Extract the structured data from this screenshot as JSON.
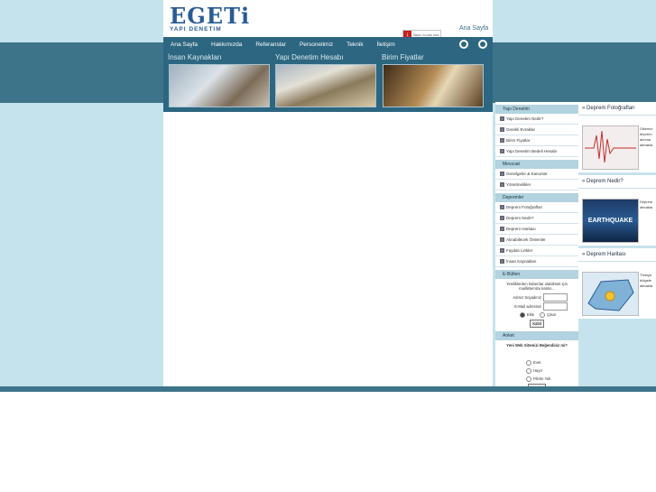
{
  "logo": {
    "word": "EGETi",
    "sub": "YAPI DENETIM"
  },
  "header": {
    "ana_sayfa": "Ana Sayfa",
    "badge_icon": "pdf-icon",
    "badge_text": "İNDİR / KLASİK SİTE"
  },
  "nav": [
    "Ana Sayfa",
    "Hakkımızda",
    "Referanslar",
    "Personelimiz",
    "Teknik",
    "İletişim"
  ],
  "hero": [
    {
      "title": "İnsan Kaynakları"
    },
    {
      "title": "Yapı Denetim Hesabı"
    },
    {
      "title": "Birim Fiyatlar"
    }
  ],
  "sidebar": {
    "yapi_denetim": {
      "title": "Yapı Denetim",
      "items": [
        "Yapı Denetim Nedir?",
        "Gerekli Evraklar",
        "Birim Fiyatlar",
        "Yapı Denetim Bedeli Hesabı"
      ]
    },
    "mevzuat": {
      "title": "Mevzuat",
      "items": [
        "Genelgeler & Kanunlar",
        "Yönetmelikler"
      ]
    },
    "depremler": {
      "title": "Depremler",
      "items": [
        "Deprem Fotoğrafları",
        "Deprem Nedir?",
        "Deprem Haritası",
        "Alınabilecek Önlemler",
        "Faydalı Linkler",
        "İnsan Kaynakları"
      ]
    },
    "ebulten": {
      "title": "E-Bülten",
      "desc": "Yeniliklerden haberdar olabilmek için maillistemize katılın...",
      "name_label": "Adınız Soyadınız",
      "email_label": "E-Mail adresiniz",
      "opt_add": "Ekle",
      "opt_remove": "Çıkar",
      "submit": "Kabil"
    },
    "anket": {
      "title": "Anket",
      "question": "Yeni Web Sitemizi Beğendiniz mi?",
      "options": [
        "Evet",
        "Hayır",
        "Fikrim Yok"
      ],
      "submit": "Gönder"
    }
  },
  "far_right": [
    {
      "title": "» Deprem Fotoğrafları",
      "text": "Ülkemiz deprem alınma almakta"
    },
    {
      "title": "» Deprem Nedir?",
      "image_label": "EARTHQUAKE",
      "text": "Deprem almakta"
    },
    {
      "title": "» Deprem Haritası",
      "text": "Türkiye bölgele almakta"
    }
  ],
  "colors": {
    "band": "#3e7489",
    "nav": "#2d6680",
    "bg": "#c5e3ec",
    "section": "#b2d3df"
  }
}
